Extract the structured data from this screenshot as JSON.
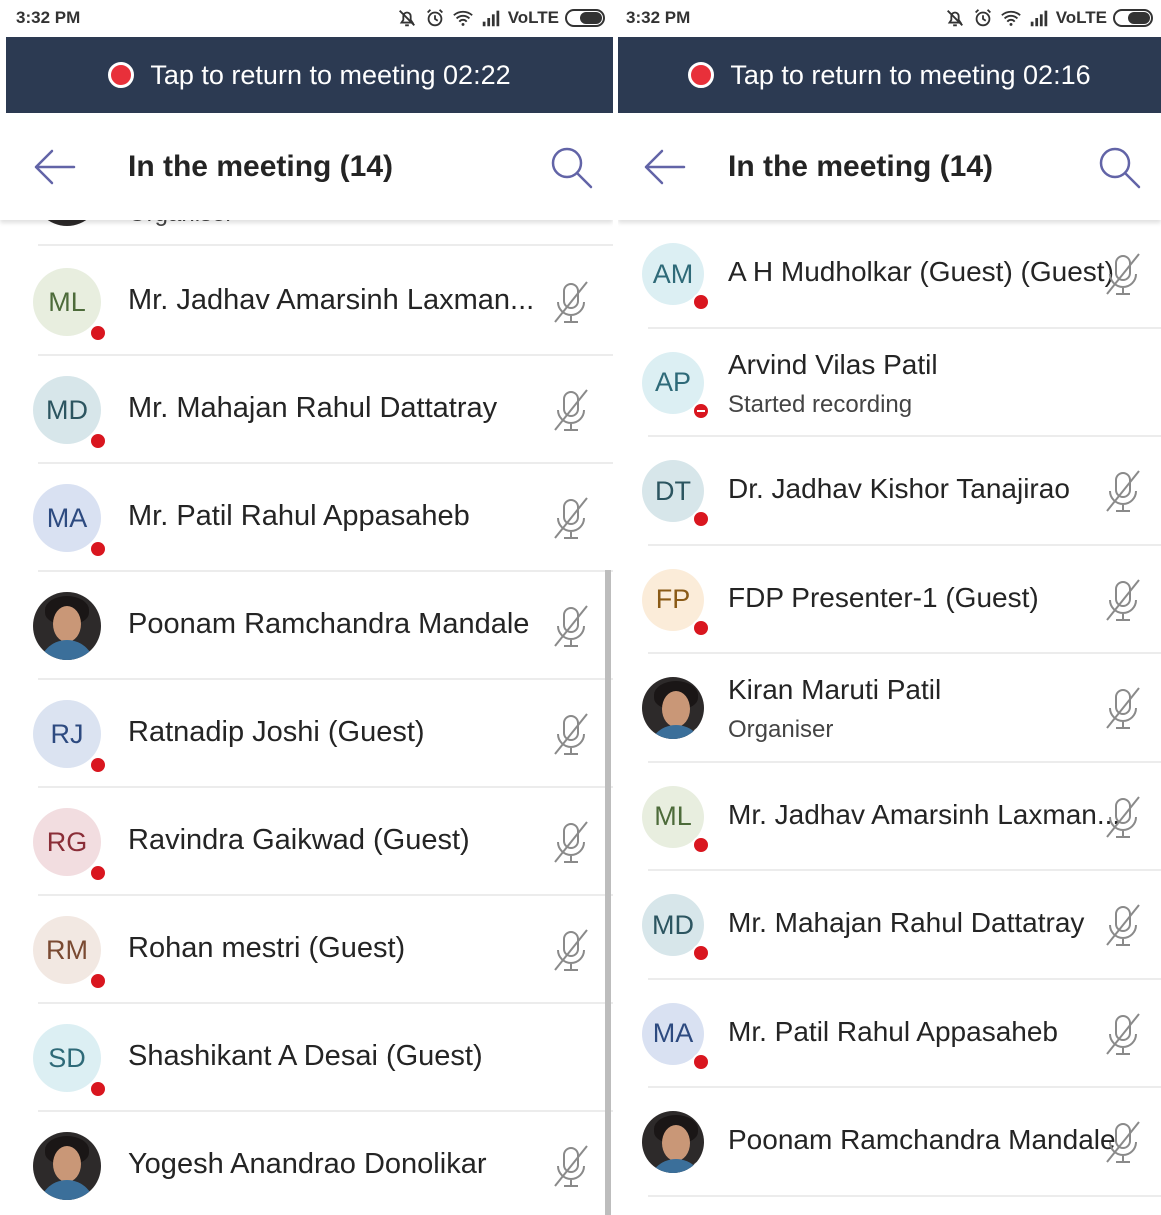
{
  "status_bar": {
    "time": "3:32 PM",
    "network": "VoLTE"
  },
  "left": {
    "banner": {
      "text": "Tap to return to meeting 02:22"
    },
    "header": {
      "title": "In the meeting (14)"
    },
    "partial_top": {
      "sub": "Organiser"
    },
    "participants": [
      {
        "initials": "ML",
        "name": "Mr. Jadhav Amarsinh Laxman...",
        "avatar_bg": "#e8eedf",
        "avatar_fg": "#4d6b3a",
        "muted": true
      },
      {
        "initials": "MD",
        "name": "Mr. Mahajan Rahul Dattatray",
        "avatar_bg": "#d7e6ea",
        "avatar_fg": "#2c5560",
        "muted": true
      },
      {
        "initials": "MA",
        "name": "Mr. Patil Rahul Appasaheb",
        "avatar_bg": "#d9e1f2",
        "avatar_fg": "#2d4a80",
        "muted": true
      },
      {
        "initials": "",
        "name": "Poonam Ramchandra  Mandale",
        "photo": true,
        "muted": true
      },
      {
        "initials": "RJ",
        "name": "Ratnadip Joshi (Guest)",
        "avatar_bg": "#dbe3f1",
        "avatar_fg": "#2d4a80",
        "muted": true
      },
      {
        "initials": "RG",
        "name": "Ravindra Gaikwad (Guest)",
        "avatar_bg": "#f2dde0",
        "avatar_fg": "#8a2e38",
        "muted": true
      },
      {
        "initials": "RM",
        "name": "Rohan mestri (Guest)",
        "avatar_bg": "#f2e8e2",
        "avatar_fg": "#7a4a32",
        "muted": true
      },
      {
        "initials": "SD",
        "name": " Shashikant A Desai (Guest)",
        "avatar_bg": "#dceff3",
        "avatar_fg": "#2e6a78",
        "muted": false
      },
      {
        "initials": "",
        "name": "Yogesh Anandrao Donolikar",
        "photo": true,
        "muted": true
      }
    ]
  },
  "right": {
    "banner": {
      "text": "Tap to return to meeting 02:16"
    },
    "header": {
      "title": "In the meeting (14)"
    },
    "participants": [
      {
        "initials": "AM",
        "name": "A H Mudholkar (Guest) (Guest)",
        "avatar_bg": "#dceff3",
        "avatar_fg": "#2e6a78",
        "muted": true
      },
      {
        "initials": "AP",
        "name": "Arvind Vilas Patil",
        "sub": "Started recording",
        "avatar_bg": "#dceff3",
        "avatar_fg": "#2e6a78",
        "muted": false,
        "dnd": true
      },
      {
        "initials": "DT",
        "name": "Dr. Jadhav Kishor Tanajirao",
        "avatar_bg": "#d7e6ea",
        "avatar_fg": "#2c5560",
        "muted": true
      },
      {
        "initials": "FP",
        "name": "FDP Presenter-1 (Guest)",
        "avatar_bg": "#fbecd9",
        "avatar_fg": "#8a5a16",
        "muted": true
      },
      {
        "initials": "",
        "name": "Kiran Maruti Patil",
        "sub": "Organiser",
        "photo": true,
        "muted": true
      },
      {
        "initials": "ML",
        "name": "Mr. Jadhav Amarsinh Laxman...",
        "avatar_bg": "#e8eedf",
        "avatar_fg": "#4d6b3a",
        "muted": true
      },
      {
        "initials": "MD",
        "name": "Mr. Mahajan Rahul Dattatray",
        "avatar_bg": "#d7e6ea",
        "avatar_fg": "#2c5560",
        "muted": true
      },
      {
        "initials": "MA",
        "name": "Mr. Patil Rahul Appasaheb",
        "avatar_bg": "#d9e1f2",
        "avatar_fg": "#2d4a80",
        "muted": true
      },
      {
        "initials": "",
        "name": "Poonam Ramchandra  Mandale",
        "photo": true,
        "muted": true
      }
    ]
  }
}
